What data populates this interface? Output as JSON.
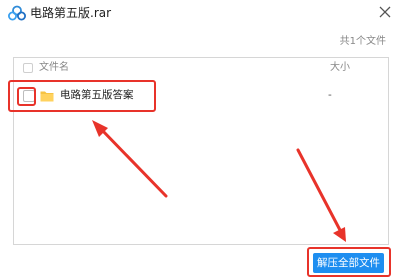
{
  "window": {
    "title": "电路第五版.rar",
    "logo_icon": "cloud-app-logo-icon",
    "close_icon": "close-icon"
  },
  "summary": "共1个文件",
  "list": {
    "header": {
      "name": "文件名",
      "size": "大小"
    },
    "rows": [
      {
        "name": "电路第五版答案",
        "size": "-",
        "icon": "folder-icon"
      }
    ]
  },
  "actions": {
    "extract_all_label": "解压全部文件"
  },
  "colors": {
    "accent": "#1e8ef0",
    "annotation": "#e8332a",
    "folder": "#f6c343"
  }
}
